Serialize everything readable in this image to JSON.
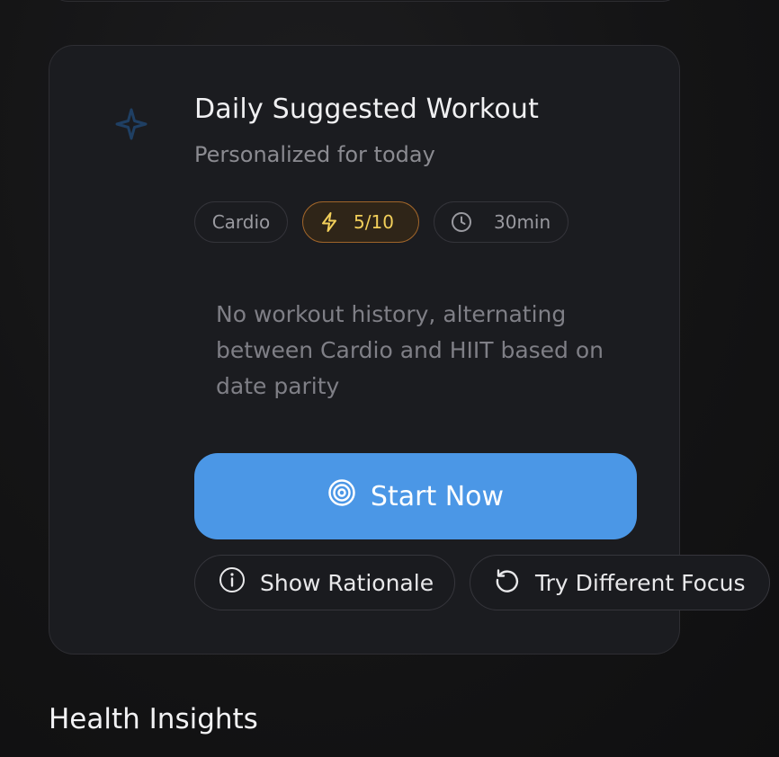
{
  "card": {
    "title": "Daily Suggested Workout",
    "subtitle": "Personalized for today",
    "icon": "sparkle-icon",
    "chips": {
      "type_label": "Cardio",
      "intensity_value": "5/10",
      "intensity_level": 0.5,
      "intensity_icon": "lightning-icon",
      "duration_value": "30min",
      "duration_icon": "clock-icon"
    },
    "rationale_text": "No workout history, alternating between Cardio and HIIT based on date parity",
    "start_button": {
      "label": "Start Now",
      "icon": "target-icon"
    },
    "show_rationale_button": {
      "label": "Show Rationale",
      "icon": "info-icon"
    },
    "try_different_focus_button": {
      "label": "Try Different Focus",
      "icon": "refresh-icon"
    }
  },
  "health_insights": {
    "title": "Health Insights"
  },
  "colors": {
    "accent": "#4b97e6",
    "intensity_text": "#f2cf5a",
    "intensity_border": "#a0652a",
    "card_bg": "#1b1c20",
    "page_bg": "#141415"
  }
}
